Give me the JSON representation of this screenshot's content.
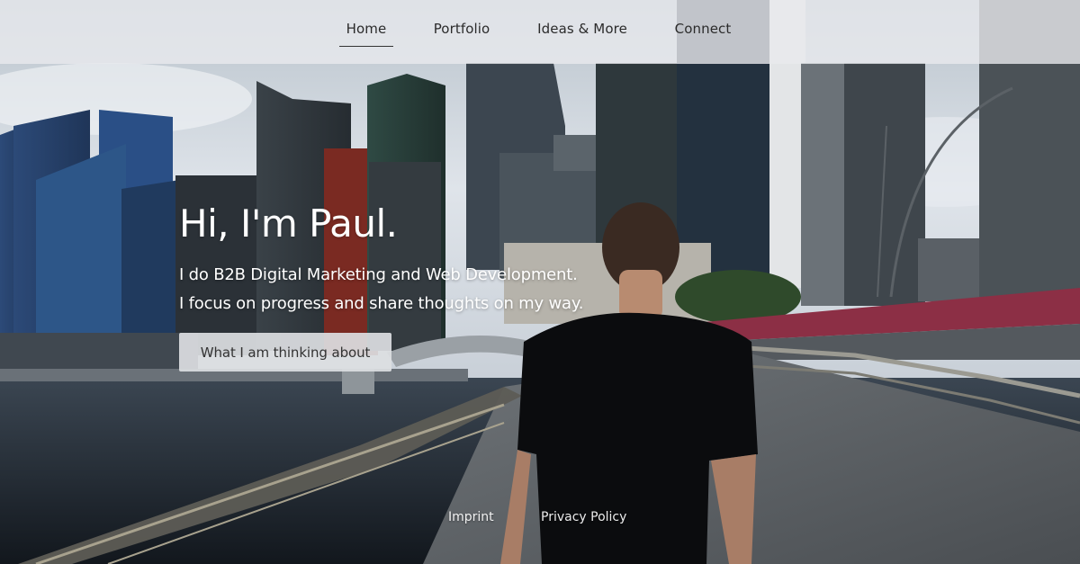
{
  "nav": {
    "items": [
      {
        "label": "Home",
        "active": true
      },
      {
        "label": "Portfolio",
        "active": false
      },
      {
        "label": "Ideas & More",
        "active": false
      },
      {
        "label": "Connect",
        "active": false
      }
    ]
  },
  "hero": {
    "title": "Hi, I'm Paul.",
    "subtitle_line1": "I do B2B Digital Marketing and Web Development.",
    "subtitle_line2": "I focus on progress and share thoughts on my way.",
    "cta_label": "What I am thinking about",
    "background_image": "person-on-bridge-in-front-of-city-skyline"
  },
  "footer": {
    "imprint_label": "Imprint",
    "privacy_label": "Privacy Policy"
  },
  "colors": {
    "nav_background": "#E8EAED",
    "text_primary": "#2B2B2B",
    "hero_text": "#FFFFFF",
    "cta_background": "#DCDEE2"
  }
}
